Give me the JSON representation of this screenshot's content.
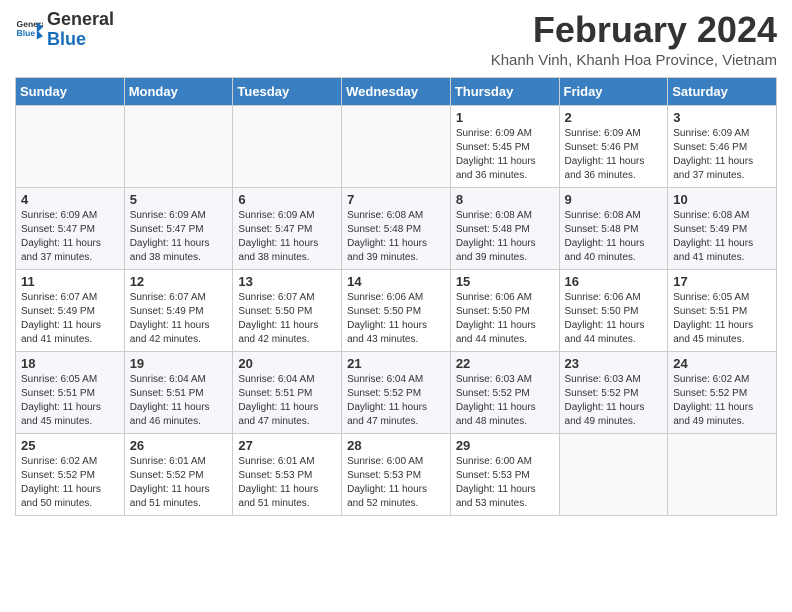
{
  "header": {
    "logo_general": "General",
    "logo_blue": "Blue",
    "month_year": "February 2024",
    "location": "Khanh Vinh, Khanh Hoa Province, Vietnam"
  },
  "weekdays": [
    "Sunday",
    "Monday",
    "Tuesday",
    "Wednesday",
    "Thursday",
    "Friday",
    "Saturday"
  ],
  "weeks": [
    [
      {
        "day": "",
        "info": ""
      },
      {
        "day": "",
        "info": ""
      },
      {
        "day": "",
        "info": ""
      },
      {
        "day": "",
        "info": ""
      },
      {
        "day": "1",
        "info": "Sunrise: 6:09 AM\nSunset: 5:45 PM\nDaylight: 11 hours\nand 36 minutes."
      },
      {
        "day": "2",
        "info": "Sunrise: 6:09 AM\nSunset: 5:46 PM\nDaylight: 11 hours\nand 36 minutes."
      },
      {
        "day": "3",
        "info": "Sunrise: 6:09 AM\nSunset: 5:46 PM\nDaylight: 11 hours\nand 37 minutes."
      }
    ],
    [
      {
        "day": "4",
        "info": "Sunrise: 6:09 AM\nSunset: 5:47 PM\nDaylight: 11 hours\nand 37 minutes."
      },
      {
        "day": "5",
        "info": "Sunrise: 6:09 AM\nSunset: 5:47 PM\nDaylight: 11 hours\nand 38 minutes."
      },
      {
        "day": "6",
        "info": "Sunrise: 6:09 AM\nSunset: 5:47 PM\nDaylight: 11 hours\nand 38 minutes."
      },
      {
        "day": "7",
        "info": "Sunrise: 6:08 AM\nSunset: 5:48 PM\nDaylight: 11 hours\nand 39 minutes."
      },
      {
        "day": "8",
        "info": "Sunrise: 6:08 AM\nSunset: 5:48 PM\nDaylight: 11 hours\nand 39 minutes."
      },
      {
        "day": "9",
        "info": "Sunrise: 6:08 AM\nSunset: 5:48 PM\nDaylight: 11 hours\nand 40 minutes."
      },
      {
        "day": "10",
        "info": "Sunrise: 6:08 AM\nSunset: 5:49 PM\nDaylight: 11 hours\nand 41 minutes."
      }
    ],
    [
      {
        "day": "11",
        "info": "Sunrise: 6:07 AM\nSunset: 5:49 PM\nDaylight: 11 hours\nand 41 minutes."
      },
      {
        "day": "12",
        "info": "Sunrise: 6:07 AM\nSunset: 5:49 PM\nDaylight: 11 hours\nand 42 minutes."
      },
      {
        "day": "13",
        "info": "Sunrise: 6:07 AM\nSunset: 5:50 PM\nDaylight: 11 hours\nand 42 minutes."
      },
      {
        "day": "14",
        "info": "Sunrise: 6:06 AM\nSunset: 5:50 PM\nDaylight: 11 hours\nand 43 minutes."
      },
      {
        "day": "15",
        "info": "Sunrise: 6:06 AM\nSunset: 5:50 PM\nDaylight: 11 hours\nand 44 minutes."
      },
      {
        "day": "16",
        "info": "Sunrise: 6:06 AM\nSunset: 5:50 PM\nDaylight: 11 hours\nand 44 minutes."
      },
      {
        "day": "17",
        "info": "Sunrise: 6:05 AM\nSunset: 5:51 PM\nDaylight: 11 hours\nand 45 minutes."
      }
    ],
    [
      {
        "day": "18",
        "info": "Sunrise: 6:05 AM\nSunset: 5:51 PM\nDaylight: 11 hours\nand 45 minutes."
      },
      {
        "day": "19",
        "info": "Sunrise: 6:04 AM\nSunset: 5:51 PM\nDaylight: 11 hours\nand 46 minutes."
      },
      {
        "day": "20",
        "info": "Sunrise: 6:04 AM\nSunset: 5:51 PM\nDaylight: 11 hours\nand 47 minutes."
      },
      {
        "day": "21",
        "info": "Sunrise: 6:04 AM\nSunset: 5:52 PM\nDaylight: 11 hours\nand 47 minutes."
      },
      {
        "day": "22",
        "info": "Sunrise: 6:03 AM\nSunset: 5:52 PM\nDaylight: 11 hours\nand 48 minutes."
      },
      {
        "day": "23",
        "info": "Sunrise: 6:03 AM\nSunset: 5:52 PM\nDaylight: 11 hours\nand 49 minutes."
      },
      {
        "day": "24",
        "info": "Sunrise: 6:02 AM\nSunset: 5:52 PM\nDaylight: 11 hours\nand 49 minutes."
      }
    ],
    [
      {
        "day": "25",
        "info": "Sunrise: 6:02 AM\nSunset: 5:52 PM\nDaylight: 11 hours\nand 50 minutes."
      },
      {
        "day": "26",
        "info": "Sunrise: 6:01 AM\nSunset: 5:52 PM\nDaylight: 11 hours\nand 51 minutes."
      },
      {
        "day": "27",
        "info": "Sunrise: 6:01 AM\nSunset: 5:53 PM\nDaylight: 11 hours\nand 51 minutes."
      },
      {
        "day": "28",
        "info": "Sunrise: 6:00 AM\nSunset: 5:53 PM\nDaylight: 11 hours\nand 52 minutes."
      },
      {
        "day": "29",
        "info": "Sunrise: 6:00 AM\nSunset: 5:53 PM\nDaylight: 11 hours\nand 53 minutes."
      },
      {
        "day": "",
        "info": ""
      },
      {
        "day": "",
        "info": ""
      }
    ]
  ]
}
